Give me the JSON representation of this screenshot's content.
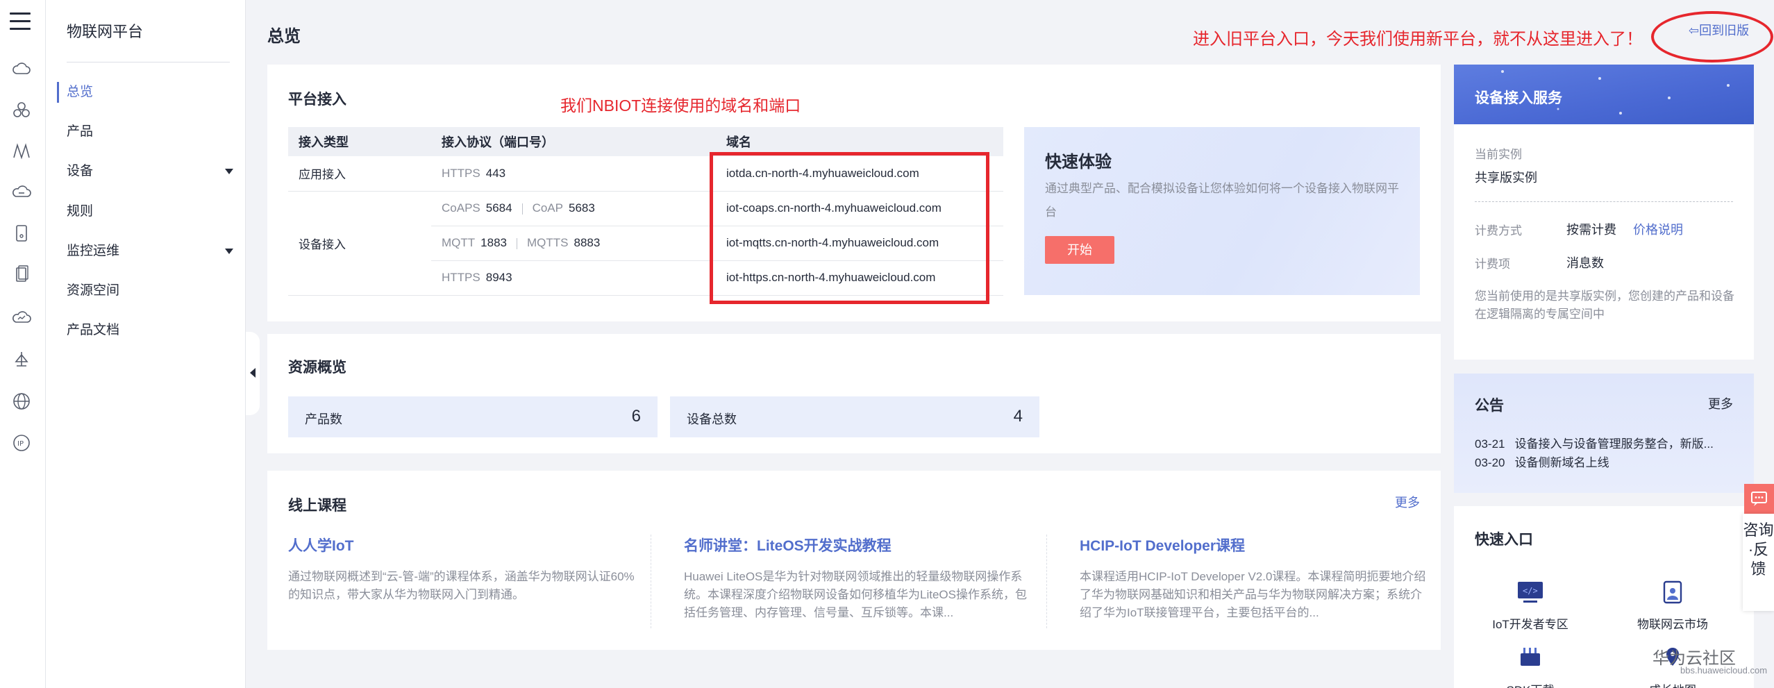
{
  "nav": {
    "title": "物联网平台",
    "items": [
      {
        "label": "总览"
      },
      {
        "label": "产品"
      },
      {
        "label": "设备"
      },
      {
        "label": "规则"
      },
      {
        "label": "监控运维"
      },
      {
        "label": "资源空间"
      },
      {
        "label": "产品文档"
      }
    ]
  },
  "header": {
    "title": "总览",
    "old_version_link": "回到旧版",
    "annotation_old": "进入旧平台入口，今天我们使用新平台，就不从这里进入了！"
  },
  "access": {
    "title": "平台接入",
    "annotation": "我们NBIOT连接使用的域名和端口",
    "columns": [
      "接入类型",
      "接入协议（端口号）",
      "域名"
    ],
    "app_type": "应用接入",
    "device_type": "设备接入",
    "rows": [
      {
        "p1": "HTTPS",
        "port1": "443",
        "p2": "",
        "port2": "",
        "domain": "iotda.cn-north-4.myhuaweicloud.com"
      },
      {
        "p1": "CoAPS",
        "port1": "5684",
        "p2": "CoAP",
        "port2": "5683",
        "domain": "iot-coaps.cn-north-4.myhuaweicloud.com"
      },
      {
        "p1": "MQTT",
        "port1": "1883",
        "p2": "MQTTS",
        "port2": "8883",
        "domain": "iot-mqtts.cn-north-4.myhuaweicloud.com"
      },
      {
        "p1": "HTTPS",
        "port1": "8943",
        "p2": "",
        "port2": "",
        "domain": "iot-https.cn-north-4.myhuaweicloud.com"
      }
    ]
  },
  "quick_try": {
    "title": "快速体验",
    "desc": "通过典型产品、配合模拟设备让您体验如何将一个设备接入物联网平台",
    "button": "开始"
  },
  "resources": {
    "title": "资源概览",
    "product_label": "产品数",
    "product_count": "6",
    "device_label": "设备总数",
    "device_count": "4"
  },
  "courses": {
    "title": "线上课程",
    "more": "更多",
    "items": [
      {
        "title": "人人学IoT",
        "desc": "通过物联网概述到“云-管-端”的课程体系，涵盖华为物联网认证60%的知识点，带大家从华为物联网入门到精通。"
      },
      {
        "title": "名师讲堂：LiteOS开发实战教程",
        "desc": "Huawei LiteOS是华为针对物联网领域推出的轻量级物联网操作系统。本课程深度介绍物联网设备如何移植华为LiteOS操作系统，包括任务管理、内存管理、信号量、互斥锁等。本课..."
      },
      {
        "title": "HCIP-IoT Developer课程",
        "desc": "本课程适用HCIP-IoT Developer V2.0课程。本课程简明扼要地介绍了华为物联网基础知识和相关产品与华为物联网解决方案；系统介绍了华为IoT联接管理平台，主要包括平台的..."
      }
    ]
  },
  "service": {
    "title": "设备接入服务",
    "instance_label": "当前实例",
    "instance_value": "共享版实例",
    "billing_label": "计费方式",
    "billing_value": "按需计费",
    "price_link": "价格说明",
    "item_label": "计费项",
    "item_value": "消息数",
    "note": "您当前使用的是共享版实例，您创建的产品和设备在逻辑隔离的专属空间中"
  },
  "notice": {
    "title": "公告",
    "more": "更多",
    "items": [
      {
        "date": "03-21",
        "text": "设备接入与设备管理服务整合，新版..."
      },
      {
        "date": "03-20",
        "text": "设备侧新域名上线"
      }
    ]
  },
  "quick_entry": {
    "title": "快速入口",
    "items": [
      {
        "label": "IoT开发者专区"
      },
      {
        "label": "物联网云市场"
      },
      {
        "label": "SDK下载"
      },
      {
        "label": "成长地图"
      }
    ]
  },
  "float": {
    "label": "咨询·反馈"
  },
  "watermark": {
    "title": "华为云社区",
    "url": "bbs.huaweicloud.com"
  },
  "colors": {
    "accent": "#526ecc",
    "annotation": "#e6262d",
    "start_button": "#f66f6a"
  }
}
